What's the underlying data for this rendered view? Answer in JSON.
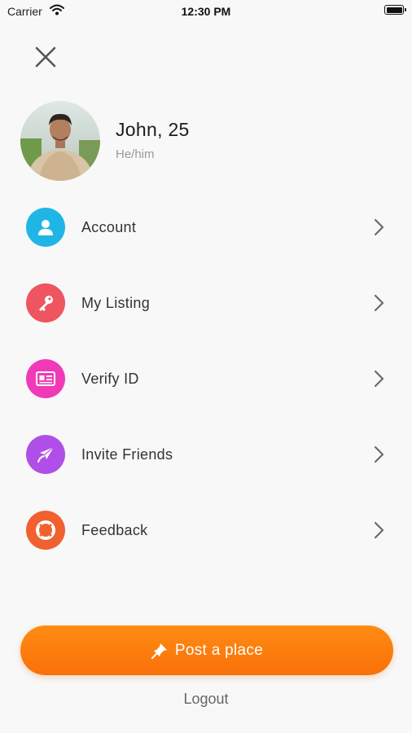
{
  "status": {
    "carrier": "Carrier",
    "time": "12:30 PM"
  },
  "profile": {
    "name": "John, 25",
    "pronoun": "He/him"
  },
  "menu": [
    {
      "label": "Account",
      "icon": "user-icon",
      "color": "#1fb6e6"
    },
    {
      "label": "My Listing",
      "icon": "key-icon",
      "color": "#ee5560"
    },
    {
      "label": "Verify ID",
      "icon": "id-card-icon",
      "color": "#f03ab8"
    },
    {
      "label": "Invite Friends",
      "icon": "paper-plane-icon",
      "color": "#b04fe8"
    },
    {
      "label": "Feedback",
      "icon": "lifebuoy-icon",
      "color": "#f0612f"
    }
  ],
  "post_button": {
    "label": "Post a place",
    "color": "#fb7d0e"
  },
  "logout": {
    "label": "Logout"
  }
}
